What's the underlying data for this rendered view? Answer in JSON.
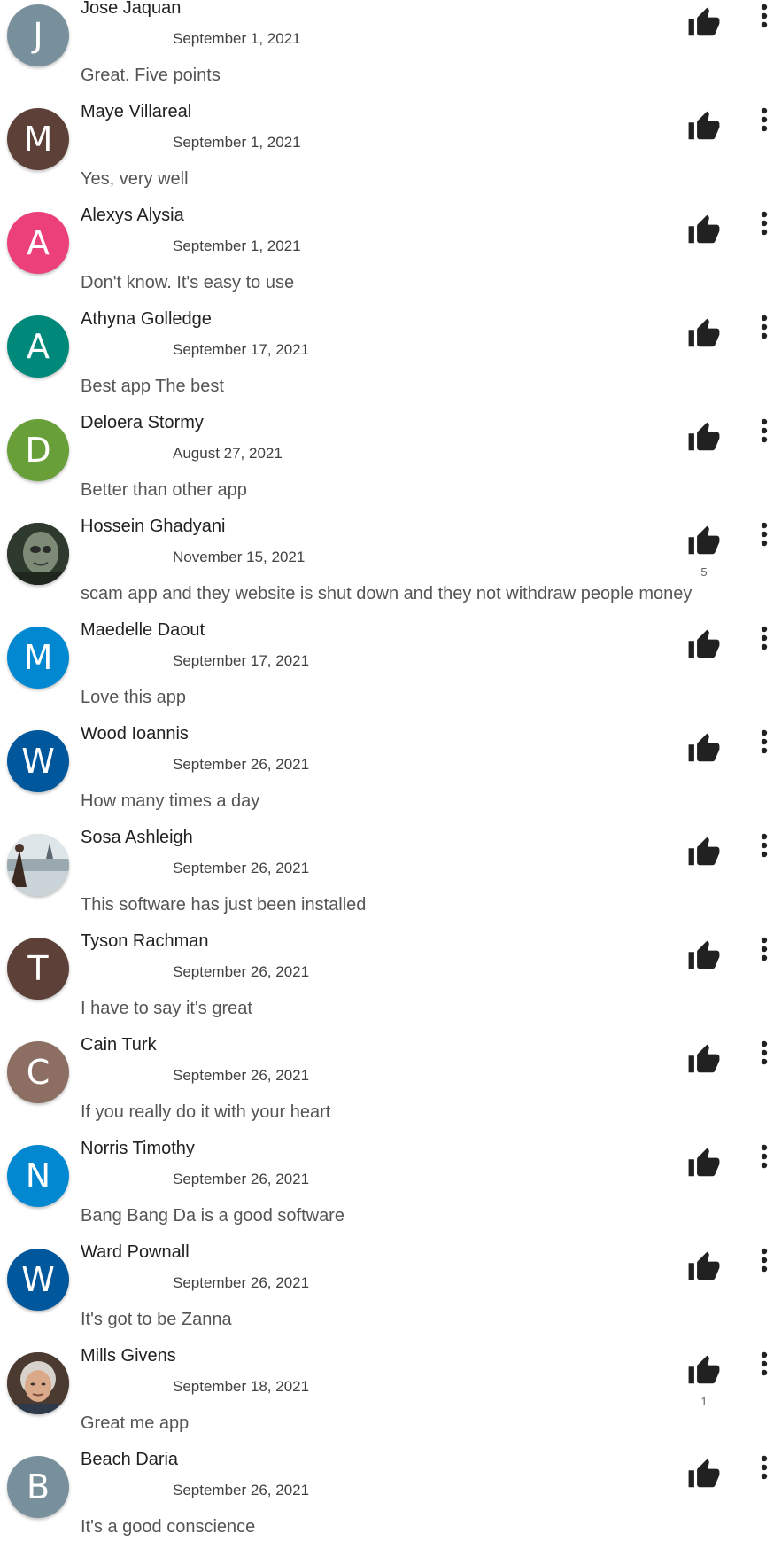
{
  "colors": {
    "text": "#212121",
    "secondary_text": "#555555",
    "icon": "#212121"
  },
  "icons": {
    "like": "thumb-up-icon",
    "menu": "more-vert-icon"
  },
  "reviews": [
    {
      "name": "Jose Jaquan",
      "date": "September 1, 2021",
      "text": "Great. Five points",
      "initial": "J",
      "avatar_color": "#78909c",
      "likes": ""
    },
    {
      "name": "Maye Villareal",
      "date": "September 1, 2021",
      "text": "Yes, very well",
      "initial": "M",
      "avatar_color": "#5d4037",
      "likes": ""
    },
    {
      "name": "Alexys Alysia",
      "date": "September 1, 2021",
      "text": "Don't know. It's easy to use",
      "initial": "A",
      "avatar_color": "#ec407a",
      "likes": ""
    },
    {
      "name": "Athyna Golledge",
      "date": "September 17, 2021",
      "text": "Best app The best",
      "initial": "A",
      "avatar_color": "#00897b",
      "likes": ""
    },
    {
      "name": "Deloera Stormy",
      "date": "August 27, 2021",
      "text": "Better than other app",
      "initial": "D",
      "avatar_color": "#689f38",
      "likes": ""
    },
    {
      "name": "Hossein Ghadyani",
      "date": "November 15, 2021",
      "text": "scam app and they website is shut down and they not withdraw people money",
      "initial": "",
      "avatar_color": "#3e4a3a",
      "photo": "photo-a",
      "likes": "5"
    },
    {
      "name": "Maedelle Daout",
      "date": "September 17, 2021",
      "text": "Love this app",
      "initial": "M",
      "avatar_color": "#0288d1",
      "likes": ""
    },
    {
      "name": "Wood Ioannis",
      "date": "September 26, 2021",
      "text": "How many times a day",
      "initial": "W",
      "avatar_color": "#01579b",
      "likes": ""
    },
    {
      "name": "Sosa Ashleigh",
      "date": "September 26, 2021",
      "text": "This software has just been installed",
      "initial": "",
      "avatar_color": "#b0bec5",
      "photo": "photo-b",
      "likes": ""
    },
    {
      "name": "Tyson Rachman",
      "date": "September 26, 2021",
      "text": "I have to say it's great",
      "initial": "T",
      "avatar_color": "#5d4037",
      "likes": ""
    },
    {
      "name": "Cain Turk",
      "date": "September 26, 2021",
      "text": "If you really do it with your heart",
      "initial": "C",
      "avatar_color": "#8d6e63",
      "likes": ""
    },
    {
      "name": "Norris Timothy",
      "date": "September 26, 2021",
      "text": "Bang Bang Da is a good software",
      "initial": "N",
      "avatar_color": "#0288d1",
      "likes": ""
    },
    {
      "name": "Ward Pownall",
      "date": "September 26, 2021",
      "text": "It's got to be Zanna",
      "initial": "W",
      "avatar_color": "#01579b",
      "likes": ""
    },
    {
      "name": "Mills Givens",
      "date": "September 18, 2021",
      "text": "Great me app",
      "initial": "",
      "avatar_color": "#7a6a5a",
      "photo": "photo-c",
      "likes": "1"
    },
    {
      "name": "Beach Daria",
      "date": "September 26, 2021",
      "text": "It's a good conscience",
      "initial": "B",
      "avatar_color": "#78909c",
      "likes": ""
    }
  ]
}
